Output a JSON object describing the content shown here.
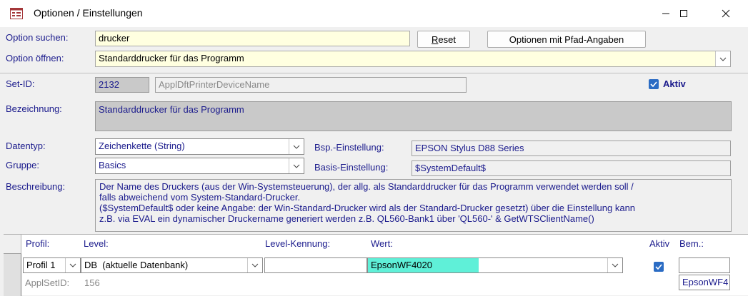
{
  "window": {
    "title": "Optionen / Einstellungen"
  },
  "search": {
    "label": "Option suchen:",
    "value": "drucker"
  },
  "buttons": {
    "reset": "Reset",
    "reset_mnemonic": "R",
    "reset_rest": "eset",
    "path_options": "Optionen mit Pfad-Angaben"
  },
  "open": {
    "label": "Option öffnen:",
    "value": "Standarddrucker für das Programm"
  },
  "setid": {
    "label": "Set-ID:",
    "value": "2132",
    "name": "ApplDftPrinterDeviceName"
  },
  "aktiv": {
    "label": "Aktiv",
    "checked": true
  },
  "bezeichnung": {
    "label": "Bezeichnung:",
    "value": "Standarddrucker für das Programm"
  },
  "datentyp": {
    "label": "Datentyp:",
    "value": "Zeichenkette (String)"
  },
  "gruppe": {
    "label": "Gruppe:",
    "value": "Basics"
  },
  "bsp": {
    "label": "Bsp.-Einstellung:",
    "value": "EPSON Stylus D88 Series"
  },
  "basis": {
    "label": "Basis-Einstellung:",
    "value": "$SystemDefault$"
  },
  "beschreibung": {
    "label": "Beschreibung:",
    "text": "Der Name des Druckers (aus der Win-Systemsteuerung), der allg. als Standarddrucker für das Programm verwendet werden soll /\nfalls abweichend vom System-Standard-Drucker.\n($SystemDefault$ oder keine Angabe: der Win-Standard-Drucker wird als der Standard-Drucker gesetzt) über die Einstellung kann\nz.B. via EVAL ein dynamischer Druckername generiert werden z.B. QL560-Bank1 über 'QL560-' & GetWTSClientName()"
  },
  "subform": {
    "headers": {
      "profil": "Profil:",
      "level": "Level:",
      "level_kennung": "Level-Kennung:",
      "wert": "Wert:",
      "aktiv": "Aktiv",
      "bem": "Bem.:"
    },
    "row": {
      "profil": "Profil 1",
      "level": "DB  (aktuelle Datenbank)",
      "level_kennung": "",
      "wert": "EpsonWF4020",
      "aktiv": true,
      "bem": "",
      "bem_below": "EpsonWF4"
    },
    "applsetid": {
      "label": "ApplSetID:",
      "value": "156"
    }
  }
}
